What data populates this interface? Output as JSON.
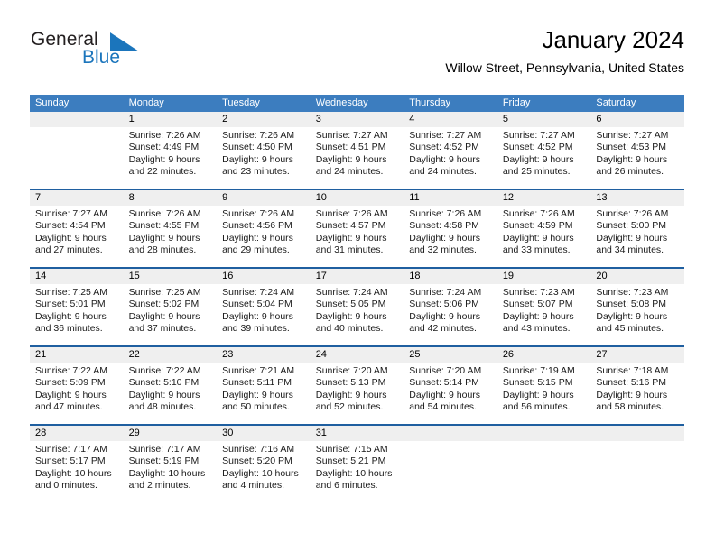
{
  "brand": {
    "name_part1": "General",
    "name_part2": "Blue",
    "accent_color": "#1b75bc"
  },
  "header": {
    "title": "January 2024",
    "subtitle": "Willow Street, Pennsylvania, United States",
    "header_bar_color": "#3c7dbf",
    "separator_color": "#1f5fa0",
    "daynum_band_color": "#efefef"
  },
  "weekdays": [
    "Sunday",
    "Monday",
    "Tuesday",
    "Wednesday",
    "Thursday",
    "Friday",
    "Saturday"
  ],
  "labels": {
    "sunrise_prefix": "Sunrise: ",
    "sunset_prefix": "Sunset: ",
    "daylight_prefix": "Daylight: "
  },
  "weeks": [
    {
      "days": [
        {
          "date": "",
          "sunrise": "",
          "sunset": "",
          "daylight_line1": "",
          "daylight_line2": ""
        },
        {
          "date": "1",
          "sunrise": "Sunrise: 7:26 AM",
          "sunset": "Sunset: 4:49 PM",
          "daylight_line1": "Daylight: 9 hours",
          "daylight_line2": "and 22 minutes."
        },
        {
          "date": "2",
          "sunrise": "Sunrise: 7:26 AM",
          "sunset": "Sunset: 4:50 PM",
          "daylight_line1": "Daylight: 9 hours",
          "daylight_line2": "and 23 minutes."
        },
        {
          "date": "3",
          "sunrise": "Sunrise: 7:27 AM",
          "sunset": "Sunset: 4:51 PM",
          "daylight_line1": "Daylight: 9 hours",
          "daylight_line2": "and 24 minutes."
        },
        {
          "date": "4",
          "sunrise": "Sunrise: 7:27 AM",
          "sunset": "Sunset: 4:52 PM",
          "daylight_line1": "Daylight: 9 hours",
          "daylight_line2": "and 24 minutes."
        },
        {
          "date": "5",
          "sunrise": "Sunrise: 7:27 AM",
          "sunset": "Sunset: 4:52 PM",
          "daylight_line1": "Daylight: 9 hours",
          "daylight_line2": "and 25 minutes."
        },
        {
          "date": "6",
          "sunrise": "Sunrise: 7:27 AM",
          "sunset": "Sunset: 4:53 PM",
          "daylight_line1": "Daylight: 9 hours",
          "daylight_line2": "and 26 minutes."
        }
      ]
    },
    {
      "days": [
        {
          "date": "7",
          "sunrise": "Sunrise: 7:27 AM",
          "sunset": "Sunset: 4:54 PM",
          "daylight_line1": "Daylight: 9 hours",
          "daylight_line2": "and 27 minutes."
        },
        {
          "date": "8",
          "sunrise": "Sunrise: 7:26 AM",
          "sunset": "Sunset: 4:55 PM",
          "daylight_line1": "Daylight: 9 hours",
          "daylight_line2": "and 28 minutes."
        },
        {
          "date": "9",
          "sunrise": "Sunrise: 7:26 AM",
          "sunset": "Sunset: 4:56 PM",
          "daylight_line1": "Daylight: 9 hours",
          "daylight_line2": "and 29 minutes."
        },
        {
          "date": "10",
          "sunrise": "Sunrise: 7:26 AM",
          "sunset": "Sunset: 4:57 PM",
          "daylight_line1": "Daylight: 9 hours",
          "daylight_line2": "and 31 minutes."
        },
        {
          "date": "11",
          "sunrise": "Sunrise: 7:26 AM",
          "sunset": "Sunset: 4:58 PM",
          "daylight_line1": "Daylight: 9 hours",
          "daylight_line2": "and 32 minutes."
        },
        {
          "date": "12",
          "sunrise": "Sunrise: 7:26 AM",
          "sunset": "Sunset: 4:59 PM",
          "daylight_line1": "Daylight: 9 hours",
          "daylight_line2": "and 33 minutes."
        },
        {
          "date": "13",
          "sunrise": "Sunrise: 7:26 AM",
          "sunset": "Sunset: 5:00 PM",
          "daylight_line1": "Daylight: 9 hours",
          "daylight_line2": "and 34 minutes."
        }
      ]
    },
    {
      "days": [
        {
          "date": "14",
          "sunrise": "Sunrise: 7:25 AM",
          "sunset": "Sunset: 5:01 PM",
          "daylight_line1": "Daylight: 9 hours",
          "daylight_line2": "and 36 minutes."
        },
        {
          "date": "15",
          "sunrise": "Sunrise: 7:25 AM",
          "sunset": "Sunset: 5:02 PM",
          "daylight_line1": "Daylight: 9 hours",
          "daylight_line2": "and 37 minutes."
        },
        {
          "date": "16",
          "sunrise": "Sunrise: 7:24 AM",
          "sunset": "Sunset: 5:04 PM",
          "daylight_line1": "Daylight: 9 hours",
          "daylight_line2": "and 39 minutes."
        },
        {
          "date": "17",
          "sunrise": "Sunrise: 7:24 AM",
          "sunset": "Sunset: 5:05 PM",
          "daylight_line1": "Daylight: 9 hours",
          "daylight_line2": "and 40 minutes."
        },
        {
          "date": "18",
          "sunrise": "Sunrise: 7:24 AM",
          "sunset": "Sunset: 5:06 PM",
          "daylight_line1": "Daylight: 9 hours",
          "daylight_line2": "and 42 minutes."
        },
        {
          "date": "19",
          "sunrise": "Sunrise: 7:23 AM",
          "sunset": "Sunset: 5:07 PM",
          "daylight_line1": "Daylight: 9 hours",
          "daylight_line2": "and 43 minutes."
        },
        {
          "date": "20",
          "sunrise": "Sunrise: 7:23 AM",
          "sunset": "Sunset: 5:08 PM",
          "daylight_line1": "Daylight: 9 hours",
          "daylight_line2": "and 45 minutes."
        }
      ]
    },
    {
      "days": [
        {
          "date": "21",
          "sunrise": "Sunrise: 7:22 AM",
          "sunset": "Sunset: 5:09 PM",
          "daylight_line1": "Daylight: 9 hours",
          "daylight_line2": "and 47 minutes."
        },
        {
          "date": "22",
          "sunrise": "Sunrise: 7:22 AM",
          "sunset": "Sunset: 5:10 PM",
          "daylight_line1": "Daylight: 9 hours",
          "daylight_line2": "and 48 minutes."
        },
        {
          "date": "23",
          "sunrise": "Sunrise: 7:21 AM",
          "sunset": "Sunset: 5:11 PM",
          "daylight_line1": "Daylight: 9 hours",
          "daylight_line2": "and 50 minutes."
        },
        {
          "date": "24",
          "sunrise": "Sunrise: 7:20 AM",
          "sunset": "Sunset: 5:13 PM",
          "daylight_line1": "Daylight: 9 hours",
          "daylight_line2": "and 52 minutes."
        },
        {
          "date": "25",
          "sunrise": "Sunrise: 7:20 AM",
          "sunset": "Sunset: 5:14 PM",
          "daylight_line1": "Daylight: 9 hours",
          "daylight_line2": "and 54 minutes."
        },
        {
          "date": "26",
          "sunrise": "Sunrise: 7:19 AM",
          "sunset": "Sunset: 5:15 PM",
          "daylight_line1": "Daylight: 9 hours",
          "daylight_line2": "and 56 minutes."
        },
        {
          "date": "27",
          "sunrise": "Sunrise: 7:18 AM",
          "sunset": "Sunset: 5:16 PM",
          "daylight_line1": "Daylight: 9 hours",
          "daylight_line2": "and 58 minutes."
        }
      ]
    },
    {
      "days": [
        {
          "date": "28",
          "sunrise": "Sunrise: 7:17 AM",
          "sunset": "Sunset: 5:17 PM",
          "daylight_line1": "Daylight: 10 hours",
          "daylight_line2": "and 0 minutes."
        },
        {
          "date": "29",
          "sunrise": "Sunrise: 7:17 AM",
          "sunset": "Sunset: 5:19 PM",
          "daylight_line1": "Daylight: 10 hours",
          "daylight_line2": "and 2 minutes."
        },
        {
          "date": "30",
          "sunrise": "Sunrise: 7:16 AM",
          "sunset": "Sunset: 5:20 PM",
          "daylight_line1": "Daylight: 10 hours",
          "daylight_line2": "and 4 minutes."
        },
        {
          "date": "31",
          "sunrise": "Sunrise: 7:15 AM",
          "sunset": "Sunset: 5:21 PM",
          "daylight_line1": "Daylight: 10 hours",
          "daylight_line2": "and 6 minutes."
        },
        {
          "date": "",
          "sunrise": "",
          "sunset": "",
          "daylight_line1": "",
          "daylight_line2": ""
        },
        {
          "date": "",
          "sunrise": "",
          "sunset": "",
          "daylight_line1": "",
          "daylight_line2": ""
        },
        {
          "date": "",
          "sunrise": "",
          "sunset": "",
          "daylight_line1": "",
          "daylight_line2": ""
        }
      ]
    }
  ]
}
